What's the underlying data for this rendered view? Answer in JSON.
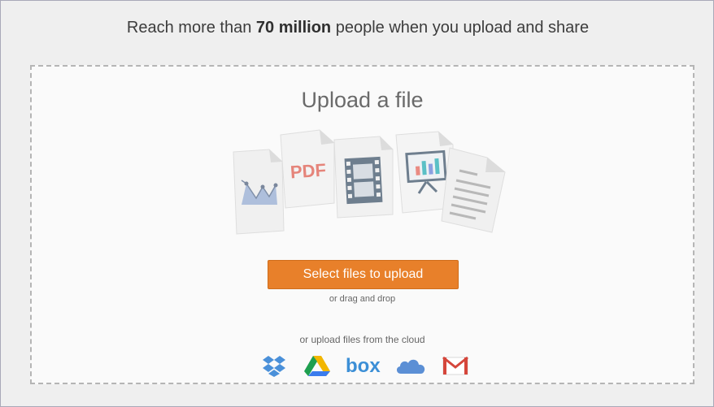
{
  "header": {
    "headline_prefix": "Reach more than ",
    "headline_bold": "70 million",
    "headline_suffix": " people when you upload and share"
  },
  "upload": {
    "title": "Upload a file",
    "illustration_pdf_label": "PDF",
    "select_button_label": "Select files to upload",
    "drag_text": "or drag and drop",
    "cloud_text": "or upload files from the cloud",
    "box_label": "box"
  },
  "cloud_services": [
    {
      "name": "Dropbox",
      "icon": "dropbox-icon",
      "color": "#4a90d9"
    },
    {
      "name": "Google Drive",
      "icon": "google-drive-icon",
      "color": "#f2b600"
    },
    {
      "name": "Box",
      "icon": "box-icon",
      "color": "#3c8fd6"
    },
    {
      "name": "OneDrive",
      "icon": "onedrive-icon",
      "color": "#5b8fd5"
    },
    {
      "name": "Gmail",
      "icon": "gmail-icon",
      "color": "#d5463b"
    }
  ],
  "colors": {
    "accent": "#e8802a",
    "background": "#efefef",
    "dropzone": "#fafafa"
  }
}
